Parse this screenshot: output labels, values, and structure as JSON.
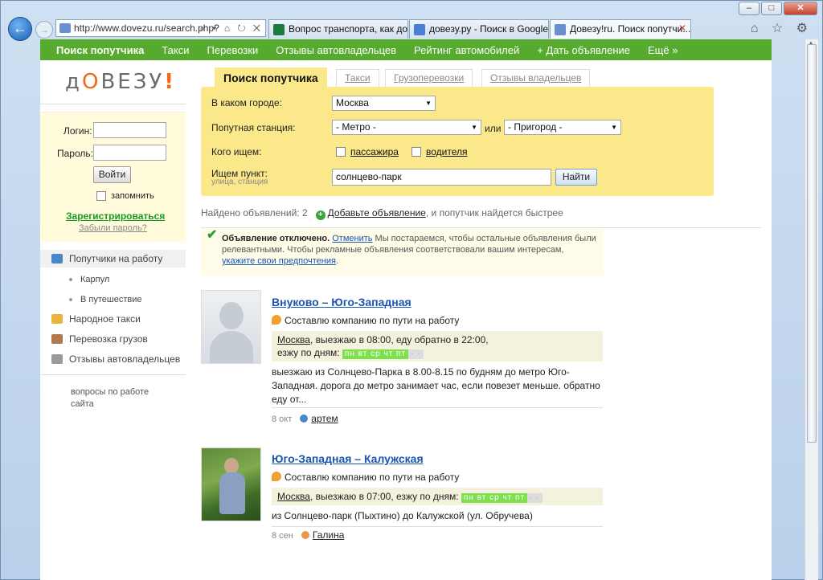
{
  "browser": {
    "address": "http://www.dovezu.ru/search.php?",
    "address_actions": "⌕ ▾ ⌂ ↻ ✕",
    "tabs": [
      {
        "label": "Вопрос транспорта, как доби..."
      },
      {
        "label": "довезу.ру - Поиск в Google"
      },
      {
        "label": "Довезу!ru. Поиск попутчи..."
      }
    ],
    "window_controls": {
      "min": "–",
      "max": "□",
      "close": "✕"
    },
    "toolbar_icons": "⌂ ☆ ⚙"
  },
  "topnav": [
    "Поиск попутчика",
    "Такси",
    "Перевозки",
    "Отзывы автовладельцев",
    "Рейтинг автомобилей",
    "+ Дать объявление",
    "Ещё »"
  ],
  "logo": {
    "part1": "д",
    "o": "О",
    "part2": "ВЕЗУ",
    "ex": "!"
  },
  "login": {
    "login_label": "Логин:",
    "password_label": "Пароль:",
    "submit": "Войти",
    "remember": "запомнить",
    "register": "Зарегистрироваться",
    "forgot": "Забыли пароль?"
  },
  "sidebar": {
    "items": [
      {
        "label": "Попутчики на работу",
        "color": "#4a86c8"
      },
      {
        "label": "Карпул"
      },
      {
        "label": "В путешествие"
      },
      {
        "label": "Народное такси",
        "color": "#e8b640"
      },
      {
        "label": "Перевозка грузов",
        "color": "#b07a4a"
      },
      {
        "label": "Отзывы автовладельцев",
        "color": "#9a9a9a"
      }
    ],
    "note": "вопросы по работе сайта"
  },
  "search_tabs": [
    "Поиск попутчика",
    "Такси",
    "Грузоперевозки",
    "Отзывы владельцев"
  ],
  "search": {
    "city_label": "В каком городе:",
    "city_value": "Москва",
    "station_label": "Попутная станция:",
    "metro_value": "- Метро -",
    "or": "или",
    "suburb_value": "- Пригород -",
    "who_label": "Кого ищем:",
    "passenger": "пассажира",
    "driver": "водителя",
    "point_label": "Ищем пункт:",
    "point_hint": "улица, станция",
    "point_value": "солнцево-парк",
    "submit": "Найти"
  },
  "results": {
    "found_prefix": "Найдено объявлений: 2",
    "add_link": "Добавьте объявление",
    "add_suffix": ", и попутчик найдется быстрее"
  },
  "ad_notice": {
    "bold": "Объявление отключено.",
    "cancel": "Отменить",
    "text1": " Мы постараемся, чтобы остальные объявления были релевантными. Чтобы рекламные объявления соответствовали вашим интересам, ",
    "prefs": "укажите свои предпочтения",
    "dot": "."
  },
  "listings": [
    {
      "title": "Внуково – Юго-Западная",
      "offer": "Составлю компанию по пути на работу",
      "city": "Москва",
      "route": ", выезжаю в 08:00, еду обратно в 22:00,",
      "days_label": "езжу по дням:",
      "days": "пн вт ср чт пт",
      "days_off": "· ·",
      "desc": "выезжаю из Солнцево-Парка в 8.00-8.15 по будням до метро Юго-Западная. дорога до метро занимает час, если повезет меньше. обратно еду от...",
      "date": "8 окт",
      "user": "артем"
    },
    {
      "title": "Юго-Западная – Калужская",
      "offer": "Составлю компанию по пути на работу",
      "city": "Москва",
      "route": ", выезжаю в 07:00, езжу по дням:",
      "days": "пн вт ср чт пт",
      "days_off": "· ·",
      "desc": "из Солнцево-парк (Пыхтино) до Калужской (ул. Обручева)",
      "date": "8 сен",
      "user": "Галина"
    }
  ],
  "colors": {
    "green_nav": "#56aa2d",
    "search_bg": "#fbe88a",
    "link": "#1a55b0",
    "logo_accent": "#f46a10"
  }
}
